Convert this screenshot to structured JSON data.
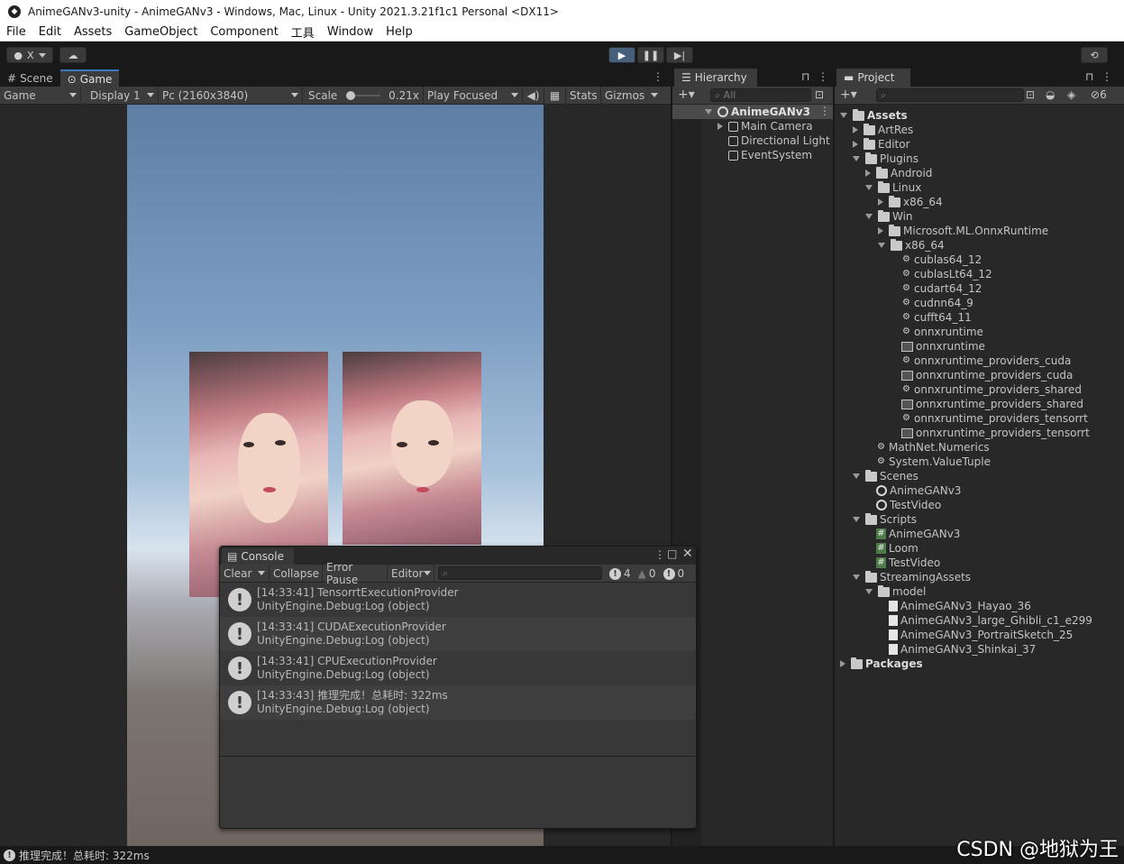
{
  "window": {
    "title": "AnimeGANv3-unity - AnimeGANv3 - Windows, Mac, Linux - Unity 2021.3.21f1c1 Personal <DX11>"
  },
  "menu": [
    "File",
    "Edit",
    "Assets",
    "GameObject",
    "Component",
    "工具",
    "Window",
    "Help"
  ],
  "toolbar": {
    "account_label": "X"
  },
  "game": {
    "tabs": [
      "Scene",
      "Game"
    ],
    "active_tab": "Game",
    "mode": "Game",
    "display": "Display 1",
    "resolution": "Pc (2160x3840)",
    "scale_label": "Scale",
    "scale_value": "0.21x",
    "play_mode": "Play Focused",
    "stats": "Stats",
    "gizmos": "Gizmos"
  },
  "hierarchy": {
    "title": "Hierarchy",
    "search_placeholder": "All",
    "scene": "AnimeGANv3",
    "items": [
      "Main Camera",
      "Directional Light",
      "EventSystem"
    ]
  },
  "project": {
    "title": "Project",
    "hidden_count": "6",
    "tree": [
      {
        "label": "Assets",
        "depth": 0,
        "icon": "folder",
        "state": "open",
        "bold": true
      },
      {
        "label": "ArtRes",
        "depth": 1,
        "icon": "folder",
        "state": "closed"
      },
      {
        "label": "Editor",
        "depth": 1,
        "icon": "folder",
        "state": "closed"
      },
      {
        "label": "Plugins",
        "depth": 1,
        "icon": "folder",
        "state": "open"
      },
      {
        "label": "Android",
        "depth": 2,
        "icon": "folder",
        "state": "closed"
      },
      {
        "label": "Linux",
        "depth": 2,
        "icon": "folder",
        "state": "open"
      },
      {
        "label": "x86_64",
        "depth": 3,
        "icon": "folder",
        "state": "closed"
      },
      {
        "label": "Win",
        "depth": 2,
        "icon": "folder",
        "state": "open"
      },
      {
        "label": "Microsoft.ML.OnnxRuntime",
        "depth": 3,
        "icon": "folder",
        "state": "closed"
      },
      {
        "label": "x86_64",
        "depth": 3,
        "icon": "folder",
        "state": "open"
      },
      {
        "label": "cublas64_12",
        "depth": 4,
        "icon": "plugin"
      },
      {
        "label": "cublasLt64_12",
        "depth": 4,
        "icon": "plugin"
      },
      {
        "label": "cudart64_12",
        "depth": 4,
        "icon": "plugin"
      },
      {
        "label": "cudnn64_9",
        "depth": 4,
        "icon": "plugin"
      },
      {
        "label": "cufft64_11",
        "depth": 4,
        "icon": "plugin"
      },
      {
        "label": "onnxruntime",
        "depth": 4,
        "icon": "plugin"
      },
      {
        "label": "onnxruntime",
        "depth": 4,
        "icon": "dll"
      },
      {
        "label": "onnxruntime_providers_cuda",
        "depth": 4,
        "icon": "plugin"
      },
      {
        "label": "onnxruntime_providers_cuda",
        "depth": 4,
        "icon": "dll"
      },
      {
        "label": "onnxruntime_providers_shared",
        "depth": 4,
        "icon": "plugin"
      },
      {
        "label": "onnxruntime_providers_shared",
        "depth": 4,
        "icon": "dll"
      },
      {
        "label": "onnxruntime_providers_tensorrt",
        "depth": 4,
        "icon": "plugin"
      },
      {
        "label": "onnxruntime_providers_tensorrt",
        "depth": 4,
        "icon": "dll"
      },
      {
        "label": "MathNet.Numerics",
        "depth": 2,
        "icon": "plugin"
      },
      {
        "label": "System.ValueTuple",
        "depth": 2,
        "icon": "plugin"
      },
      {
        "label": "Scenes",
        "depth": 1,
        "icon": "folder",
        "state": "open"
      },
      {
        "label": "AnimeGANv3",
        "depth": 2,
        "icon": "unity"
      },
      {
        "label": "TestVideo",
        "depth": 2,
        "icon": "unity"
      },
      {
        "label": "Scripts",
        "depth": 1,
        "icon": "folder",
        "state": "open"
      },
      {
        "label": "AnimeGANv3",
        "depth": 2,
        "icon": "script"
      },
      {
        "label": "Loom",
        "depth": 2,
        "icon": "script"
      },
      {
        "label": "TestVideo",
        "depth": 2,
        "icon": "script"
      },
      {
        "label": "StreamingAssets",
        "depth": 1,
        "icon": "folder",
        "state": "open"
      },
      {
        "label": "model",
        "depth": 2,
        "icon": "folder",
        "state": "open"
      },
      {
        "label": "AnimeGANv3_Hayao_36",
        "depth": 3,
        "icon": "file"
      },
      {
        "label": "AnimeGANv3_large_Ghibli_c1_e299",
        "depth": 3,
        "icon": "file"
      },
      {
        "label": "AnimeGANv3_PortraitSketch_25",
        "depth": 3,
        "icon": "file"
      },
      {
        "label": "AnimeGANv3_Shinkai_37",
        "depth": 3,
        "icon": "file"
      },
      {
        "label": "Packages",
        "depth": 0,
        "icon": "folder",
        "state": "closed",
        "bold": true
      }
    ]
  },
  "console": {
    "title": "Console",
    "clear": "Clear",
    "collapse": "Collapse",
    "error_pause": "Error Pause",
    "editor": "Editor",
    "count_log": "4",
    "count_warn": "0",
    "count_error": "0",
    "logs": [
      {
        "line1": "[14:33:41] TensorrtExecutionProvider",
        "line2": "UnityEngine.Debug:Log (object)"
      },
      {
        "line1": "[14:33:41] CUDAExecutionProvider",
        "line2": "UnityEngine.Debug:Log (object)"
      },
      {
        "line1": "[14:33:41] CPUExecutionProvider",
        "line2": "UnityEngine.Debug:Log (object)"
      },
      {
        "line1": "[14:33:43] 推理完成！总耗时: 322ms",
        "line2": "UnityEngine.Debug:Log (object)"
      }
    ]
  },
  "status": {
    "message": "推理完成！总耗时: 322ms"
  },
  "watermark": "CSDN @地狱为王"
}
